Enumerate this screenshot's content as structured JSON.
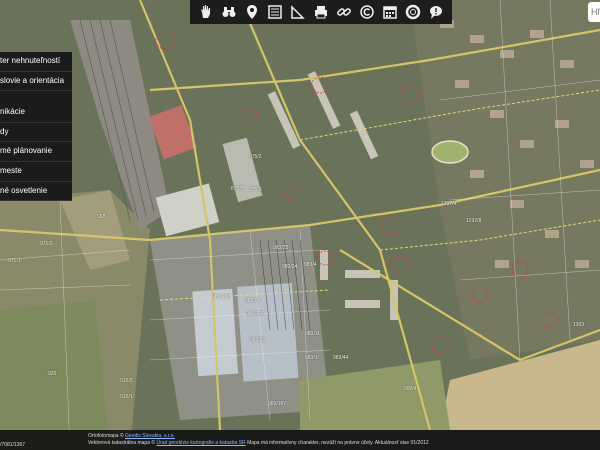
{
  "toolbar": {
    "tools": [
      "hand-icon",
      "binoculars-icon",
      "pin-icon",
      "list-icon",
      "ruler-icon",
      "print-icon",
      "link-icon",
      "copyright-icon",
      "calendar-icon",
      "lifebuoy-icon",
      "speech-bubble-icon"
    ]
  },
  "search": {
    "placeholder": "Hľ"
  },
  "menu": {
    "items": [
      "ter nehnuteľností",
      "slovie a orientácia",
      "nikácie",
      "dy",
      "mé plánovanie",
      "meste",
      "né osvetlenie"
    ]
  },
  "footer": {
    "line1_prefix": "Ortofotomapa ©",
    "line1_link": "Geodis Slovakia, s.r.o.",
    "line2_prefix": "Vektorová katastrálna mapa ©",
    "line2_link": "Úrad geodézie kartografie a katastra SR",
    "line2_suffix": "Mapa má informatívny charakter, nezáží na právne účely. Aktuálnosť stav 01/2012",
    "code": "/7081/1367"
  },
  "parcels": [
    "968",
    "971/2",
    "971/1",
    "926",
    "912/2",
    "912/1",
    "983/188",
    "983/68",
    "983/107",
    "983/25",
    "983/4",
    "983/44",
    "983/53",
    "983/1",
    "983/24",
    "983/11",
    "983/187",
    "875/3",
    "875/5",
    "875/2",
    "900/4",
    "1297/4",
    "1292/8",
    "1303"
  ]
}
